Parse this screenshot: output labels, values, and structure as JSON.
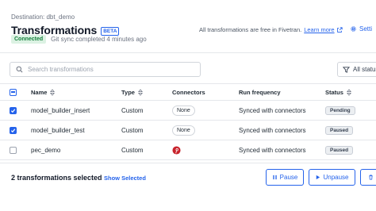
{
  "header": {
    "destination": "Destination: dbt_demo",
    "title": "Transformations",
    "beta_badge": "BETA",
    "connected_badge": "Connected",
    "sync_status": "Git sync completed 4 minutes ago",
    "free_notice": "All transformations are free in Fivetran.",
    "learn_more": "Learn more",
    "settings_label": "Setti"
  },
  "toolbar": {
    "search_placeholder": "Search transformations",
    "filter_label": "All status"
  },
  "table": {
    "columns": {
      "name": "Name",
      "type": "Type",
      "connectors": "Connectors",
      "run_frequency": "Run frequency",
      "status": "Status"
    },
    "rows": [
      {
        "checked": true,
        "name": "model_builder_insert",
        "type": "Custom",
        "connectors": "None",
        "run_frequency": "Synced with connectors",
        "status": "Pending"
      },
      {
        "checked": true,
        "name": "model_builder_test",
        "type": "Custom",
        "connectors": "None",
        "run_frequency": "Synced with connectors",
        "status": "Paused"
      },
      {
        "checked": false,
        "name": "pec_demo",
        "type": "Custom",
        "connectors": "pinterest-icon",
        "run_frequency": "Synced with connectors",
        "status": "Paused"
      }
    ]
  },
  "footer": {
    "selected_count": "2 transformations selected",
    "show_selected": "Show Selected",
    "pause_label": "Pause",
    "unpause_label": "Unpause"
  },
  "colors": {
    "accent": "#2563eb",
    "connected_bg": "#dcf2e3",
    "connected_text": "#15803d",
    "pinterest": "#c8232c"
  }
}
